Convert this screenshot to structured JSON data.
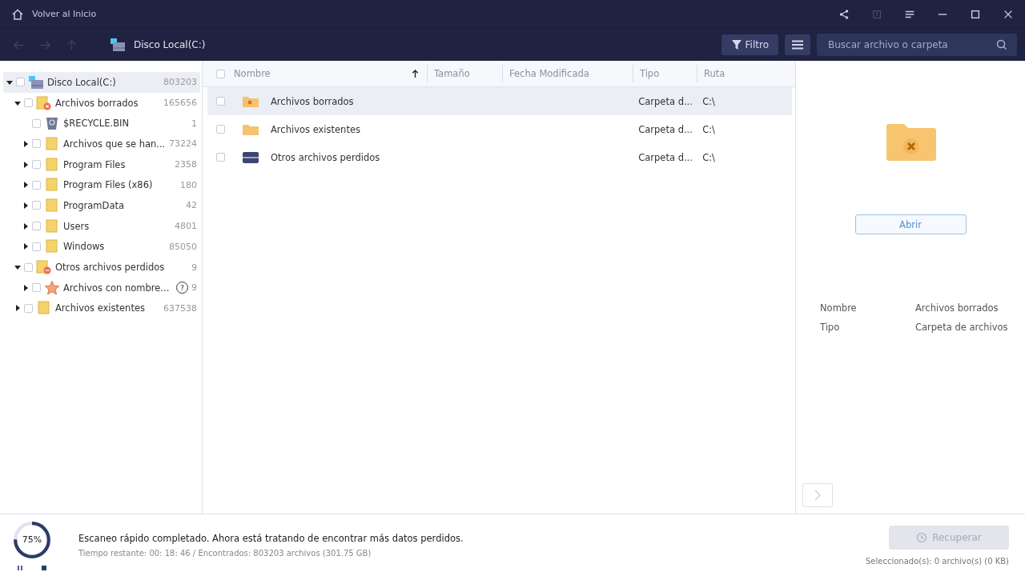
{
  "title_bar": {
    "home_label": "Volver al Inicio"
  },
  "toolbar": {
    "path": "Disco Local(C:)",
    "filter_label": "Filtro",
    "search": {
      "placeholder": "Buscar archivo o carpeta"
    }
  },
  "tree": [
    {
      "label": "Disco Local(C:)",
      "count": "803203",
      "kind": "drive",
      "expanded": true,
      "selected": true,
      "checked": false,
      "children": [
        {
          "label": "Archivos borrados",
          "count": "165656",
          "kind": "deleted",
          "expanded": true,
          "selected": false,
          "checked": false,
          "children": [
            {
              "label": "$RECYCLE.BIN",
              "count": "1",
              "kind": "recycle",
              "selected": false,
              "checked": false
            },
            {
              "label": "Archivos que se han...",
              "count": "73224",
              "kind": "folder",
              "expanded": false,
              "selected": false,
              "checked": false
            },
            {
              "label": "Program Files",
              "count": "2358",
              "kind": "folder",
              "expanded": false,
              "selected": false,
              "checked": false
            },
            {
              "label": "Program Files (x86)",
              "count": "180",
              "kind": "folder",
              "expanded": false,
              "selected": false,
              "checked": false
            },
            {
              "label": "ProgramData",
              "count": "42",
              "kind": "folder",
              "expanded": false,
              "selected": false,
              "checked": false
            },
            {
              "label": "Users",
              "count": "4801",
              "kind": "folder",
              "expanded": false,
              "selected": false,
              "checked": false
            },
            {
              "label": "Windows",
              "count": "85050",
              "kind": "folder",
              "expanded": false,
              "selected": false,
              "checked": false
            }
          ]
        },
        {
          "label": "Otros archivos perdidos",
          "count": "9",
          "kind": "lost",
          "expanded": true,
          "selected": false,
          "checked": false,
          "children": [
            {
              "label": "Archivos con nombre...",
              "count": "9",
              "kind": "star",
              "help": "?",
              "expanded": false,
              "selected": false,
              "checked": false
            }
          ]
        },
        {
          "label": "Archivos existentes",
          "count": "637538",
          "kind": "folder",
          "expanded": false,
          "selected": false,
          "checked": false
        }
      ]
    }
  ],
  "table": {
    "all_checked": false,
    "columns": [
      {
        "label": "Nombre",
        "sorted": true
      },
      {
        "label": "Tamaño",
        "sorted": false
      },
      {
        "label": "Fecha Modificada",
        "sorted": false
      },
      {
        "label": "Tipo",
        "sorted": false
      },
      {
        "label": "Ruta",
        "sorted": false
      }
    ],
    "rows": [
      {
        "name": "Archivos borrados",
        "kind": "deleted",
        "type": "Carpeta d...",
        "path": "C:\\",
        "selected": true,
        "checked": false
      },
      {
        "name": "Archivos existentes",
        "kind": "folder",
        "type": "Carpeta d...",
        "path": "C:\\",
        "selected": false,
        "checked": false
      },
      {
        "name": "Otros archivos perdidos",
        "kind": "drive",
        "type": "Carpeta d...",
        "path": "C:\\",
        "selected": false,
        "checked": false
      }
    ]
  },
  "preview": {
    "open_label": "Abrir",
    "details": [
      {
        "label": "Nombre",
        "value": "Archivos borrados"
      },
      {
        "label": "Tipo",
        "value": "Carpeta de archivos"
      }
    ]
  },
  "status": {
    "level": 0.75,
    "percent": "75%",
    "message": "Escaneo rápido completado. Ahora está tratando de encontrar más datos perdidos.",
    "detail": "Tiempo restante: 00: 18: 46 / Encontrados: 803203 archivos (301.75 GB)",
    "recover_label": "Recuperar",
    "recover_disabled": true,
    "selection": "Seleccionado(s): 0 archivo(s) (0 KB)"
  }
}
